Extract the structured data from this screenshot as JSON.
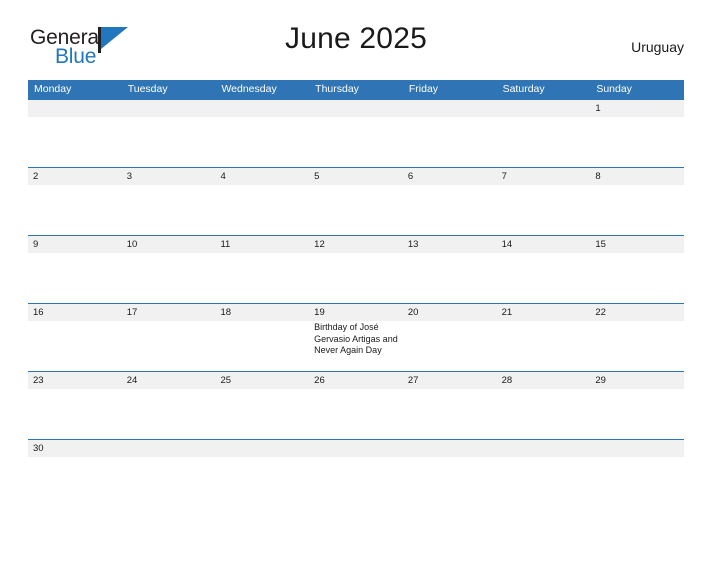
{
  "brand": {
    "name_part1": "General",
    "name_part2": "Blue",
    "flag_icon": "flag-triangle-icon"
  },
  "header": {
    "title": "June 2025",
    "country": "Uruguay"
  },
  "calendar": {
    "day_headers": [
      "Monday",
      "Tuesday",
      "Wednesday",
      "Thursday",
      "Friday",
      "Saturday",
      "Sunday"
    ],
    "colors": {
      "header_blue": "#2f75b5",
      "date_band_gray": "#f1f1f1",
      "row_divider": "#2f75b5",
      "brand_blue": "#2176bd",
      "text": "#1a1a1a"
    },
    "weeks": [
      {
        "days": [
          {
            "num": "",
            "events": []
          },
          {
            "num": "",
            "events": []
          },
          {
            "num": "",
            "events": []
          },
          {
            "num": "",
            "events": []
          },
          {
            "num": "",
            "events": []
          },
          {
            "num": "",
            "events": []
          },
          {
            "num": "1",
            "events": []
          }
        ]
      },
      {
        "days": [
          {
            "num": "2",
            "events": []
          },
          {
            "num": "3",
            "events": []
          },
          {
            "num": "4",
            "events": []
          },
          {
            "num": "5",
            "events": []
          },
          {
            "num": "6",
            "events": []
          },
          {
            "num": "7",
            "events": []
          },
          {
            "num": "8",
            "events": []
          }
        ]
      },
      {
        "days": [
          {
            "num": "9",
            "events": []
          },
          {
            "num": "10",
            "events": []
          },
          {
            "num": "11",
            "events": []
          },
          {
            "num": "12",
            "events": []
          },
          {
            "num": "13",
            "events": []
          },
          {
            "num": "14",
            "events": []
          },
          {
            "num": "15",
            "events": []
          }
        ]
      },
      {
        "days": [
          {
            "num": "16",
            "events": []
          },
          {
            "num": "17",
            "events": []
          },
          {
            "num": "18",
            "events": []
          },
          {
            "num": "19",
            "events": [
              "Birthday of José Gervasio Artigas and Never Again Day"
            ]
          },
          {
            "num": "20",
            "events": []
          },
          {
            "num": "21",
            "events": []
          },
          {
            "num": "22",
            "events": []
          }
        ]
      },
      {
        "days": [
          {
            "num": "23",
            "events": []
          },
          {
            "num": "24",
            "events": []
          },
          {
            "num": "25",
            "events": []
          },
          {
            "num": "26",
            "events": []
          },
          {
            "num": "27",
            "events": []
          },
          {
            "num": "28",
            "events": []
          },
          {
            "num": "29",
            "events": []
          }
        ]
      },
      {
        "days": [
          {
            "num": "30",
            "events": []
          },
          {
            "num": "",
            "events": []
          },
          {
            "num": "",
            "events": []
          },
          {
            "num": "",
            "events": []
          },
          {
            "num": "",
            "events": []
          },
          {
            "num": "",
            "events": []
          },
          {
            "num": "",
            "events": []
          }
        ]
      }
    ]
  }
}
